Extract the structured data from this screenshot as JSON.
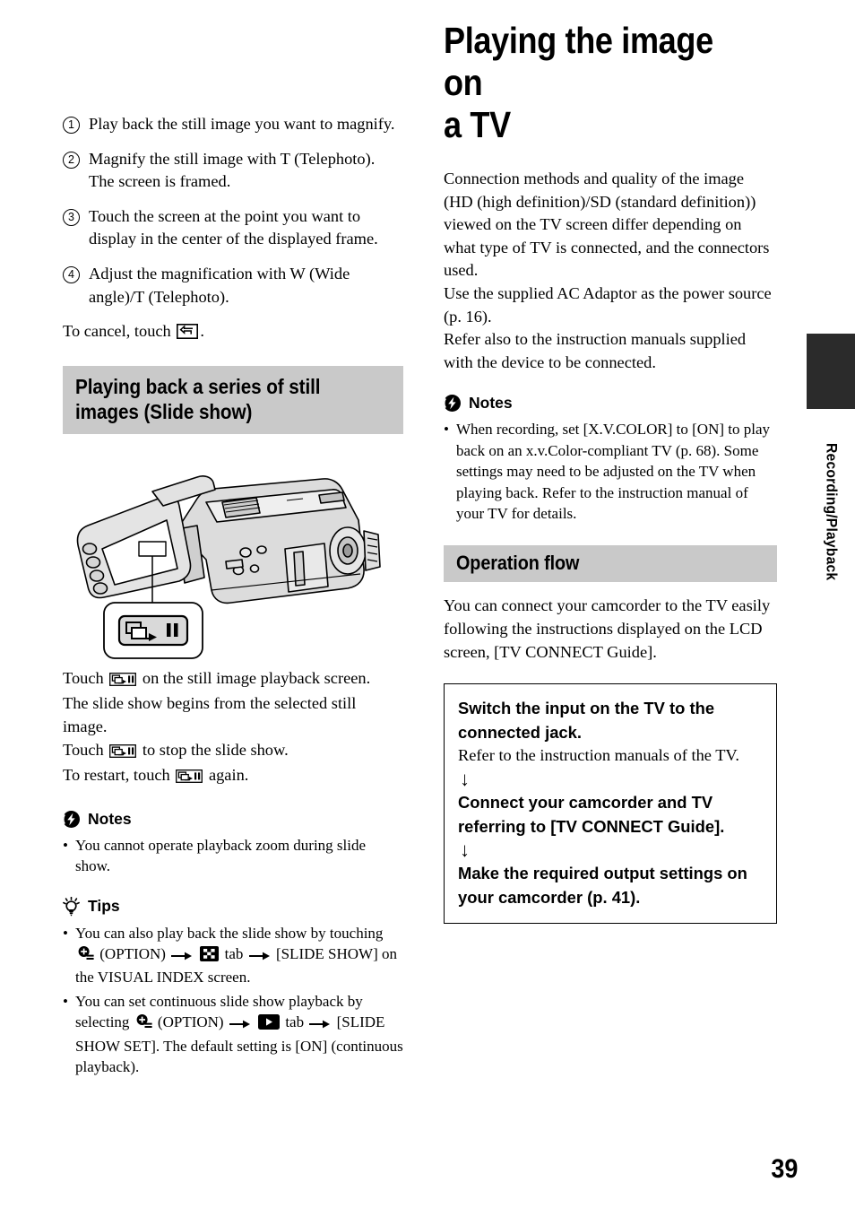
{
  "page": {
    "number": "39",
    "side_tab_label": "Recording/Playback"
  },
  "left_column": {
    "steps": [
      {
        "num": "1",
        "text": "Play back the still image you want to magnify."
      },
      {
        "num": "2",
        "text": "Magnify the still image with T (Telephoto).\nThe screen is framed."
      },
      {
        "num": "3",
        "text": "Touch the screen at the point you want to display in the center of the displayed frame."
      },
      {
        "num": "4",
        "text": "Adjust the magnification with W (Wide angle)/T (Telephoto)."
      }
    ],
    "cancel_line": {
      "before": "To cancel, touch ",
      "icon": "return-arrow-icon",
      "after": "."
    },
    "section_heading": "Playing back a series of still\nimages (Slide show)",
    "illustration": {
      "name": "camcorder-lcd-illustration",
      "callout_icon": "slideshow-pause-button-icon"
    },
    "instructions": [
      {
        "before": "Touch ",
        "icon": "slideshow-icon",
        "after": " on the still image playback screen."
      },
      {
        "before": "",
        "icon": "",
        "after": "The slide show begins from the selected still image."
      },
      {
        "before": "Touch ",
        "icon": "slideshow-icon",
        "after": " to stop the slide show."
      },
      {
        "before": "To restart, touch ",
        "icon": "slideshow-icon",
        "after": " again."
      }
    ],
    "notes": {
      "icon": "notes-lightning-icon",
      "label": "Notes",
      "items": [
        "You cannot operate playback zoom during slide show."
      ]
    },
    "tips": {
      "icon": "tips-lightbulb-icon",
      "label": "Tips",
      "items": [
        {
          "segments": [
            {
              "type": "text",
              "value": "You can also play back the slide show by touching "
            },
            {
              "type": "icon",
              "value": "option-icon"
            },
            {
              "type": "text",
              "value": " (OPTION) "
            },
            {
              "type": "icon",
              "value": "arrow-right-icon"
            },
            {
              "type": "text",
              "value": " "
            },
            {
              "type": "icon",
              "value": "checkered-tab-icon"
            },
            {
              "type": "text",
              "value": " tab "
            },
            {
              "type": "icon",
              "value": "arrow-right-icon"
            },
            {
              "type": "text",
              "value": " [SLIDE SHOW] on the VISUAL INDEX screen."
            }
          ]
        },
        {
          "segments": [
            {
              "type": "text",
              "value": "You can set continuous slide show playback by selecting "
            },
            {
              "type": "icon",
              "value": "option-icon"
            },
            {
              "type": "text",
              "value": " (OPTION) "
            },
            {
              "type": "icon",
              "value": "arrow-right-icon"
            },
            {
              "type": "text",
              "value": " "
            },
            {
              "type": "icon",
              "value": "play-tab-icon"
            },
            {
              "type": "text",
              "value": " tab "
            },
            {
              "type": "icon",
              "value": "arrow-right-icon"
            },
            {
              "type": "text",
              "value": " [SLIDE SHOW SET]. The default setting is [ON] (continuous playback)."
            }
          ]
        }
      ]
    }
  },
  "right_column": {
    "title": "Playing the image on\na TV",
    "intro_paragraphs": [
      "Connection methods and quality of the image (HD (high definition)/SD (standard definition)) viewed on the TV screen differ depending on what type of TV is connected, and the connectors used.",
      "Use the supplied AC Adaptor as the power source (p. 16).",
      "Refer also to the instruction manuals supplied with the device to be connected."
    ],
    "notes": {
      "icon": "notes-lightning-icon",
      "label": "Notes",
      "items": [
        "When recording, set [X.V.COLOR] to [ON] to play back on an x.v.Color-compliant TV (p. 68). Some settings may need to be adjusted on the TV when playing back. Refer to the instruction manual of your TV for details."
      ]
    },
    "operation_flow": {
      "heading": "Operation flow",
      "intro": "You can connect your camcorder to the TV easily following the instructions displayed on the LCD screen, [TV CONNECT Guide].",
      "steps": [
        {
          "title": "Switch the input on the TV to the connected jack.",
          "sub": "Refer to the instruction manuals of the TV."
        },
        {
          "title": "Connect your camcorder and TV referring to [TV CONNECT Guide].",
          "sub": ""
        },
        {
          "title": "Make the required output settings on your camcorder (p. 41).",
          "sub": ""
        }
      ],
      "arrow_glyph": "↓"
    }
  },
  "colors": {
    "heading_grey": "#c9c9c9",
    "side_tab_dark": "#2b2b2b",
    "ink": "#000000",
    "paper": "#ffffff"
  }
}
